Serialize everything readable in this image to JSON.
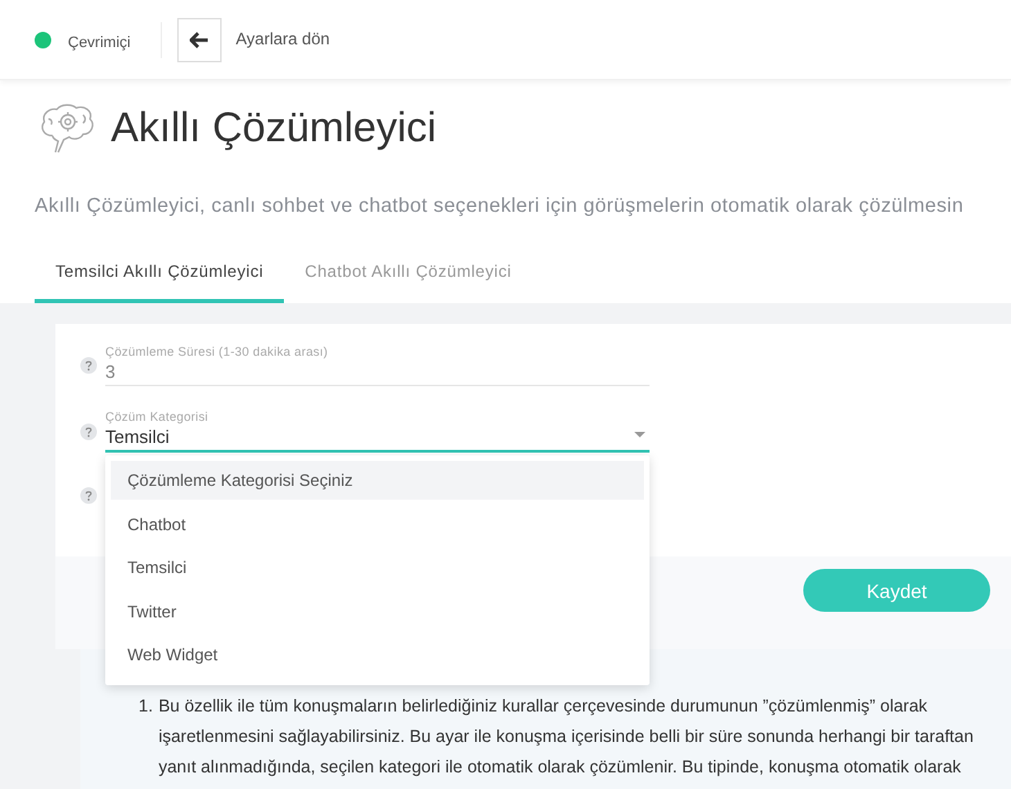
{
  "topbar": {
    "status": {
      "label": "Çevrimiçi",
      "online": true
    },
    "back_label": "Ayarlara dön"
  },
  "title": "Akıllı Çözümleyici",
  "description": "Akıllı Çözümleyici, canlı sohbet ve chatbot seçenekleri için görüşmelerin otomatik olarak çözülmesin",
  "tabs": [
    {
      "label": "Temsilci Akıllı Çözümleyici",
      "selected": true
    },
    {
      "label": "Chatbot Akıllı Çözümleyici",
      "selected": false
    }
  ],
  "fields": [
    {
      "kind": "text",
      "label": "Çözümleme Süresi (1-30 dakika arası)",
      "value": "3",
      "focused": false
    },
    {
      "kind": "select",
      "label": "Çözüm Kategorisi",
      "value": "Temsilci",
      "focused": true
    },
    {
      "kind": "covered"
    }
  ],
  "dropdown": {
    "options": [
      {
        "label": "Çözümleme Kategorisi Seçiniz",
        "hovered": true
      },
      {
        "label": "Chatbot",
        "hovered": false
      },
      {
        "label": "Temsilci",
        "hovered": false
      },
      {
        "label": "Twitter",
        "hovered": false
      },
      {
        "label": "Web Widget",
        "hovered": false
      }
    ]
  },
  "save_button": "Kaydet",
  "info": {
    "items": [
      {
        "number": "1.",
        "text": "Bu özellik ile tüm konuşmaların belirlediğiniz kurallar çerçevesinde durumunun ”çözümlenmiş” olarak işaretlenmesini sağlayabilirsiniz. Bu ayar ile konuşma içerisinde belli bir süre sonunda herhangi bir taraftan yanıt alınmadığında, seçilen kategori ile otomatik olarak çözümlenir. Bu tipinde, konuşma otomatik olarak"
      }
    ]
  }
}
